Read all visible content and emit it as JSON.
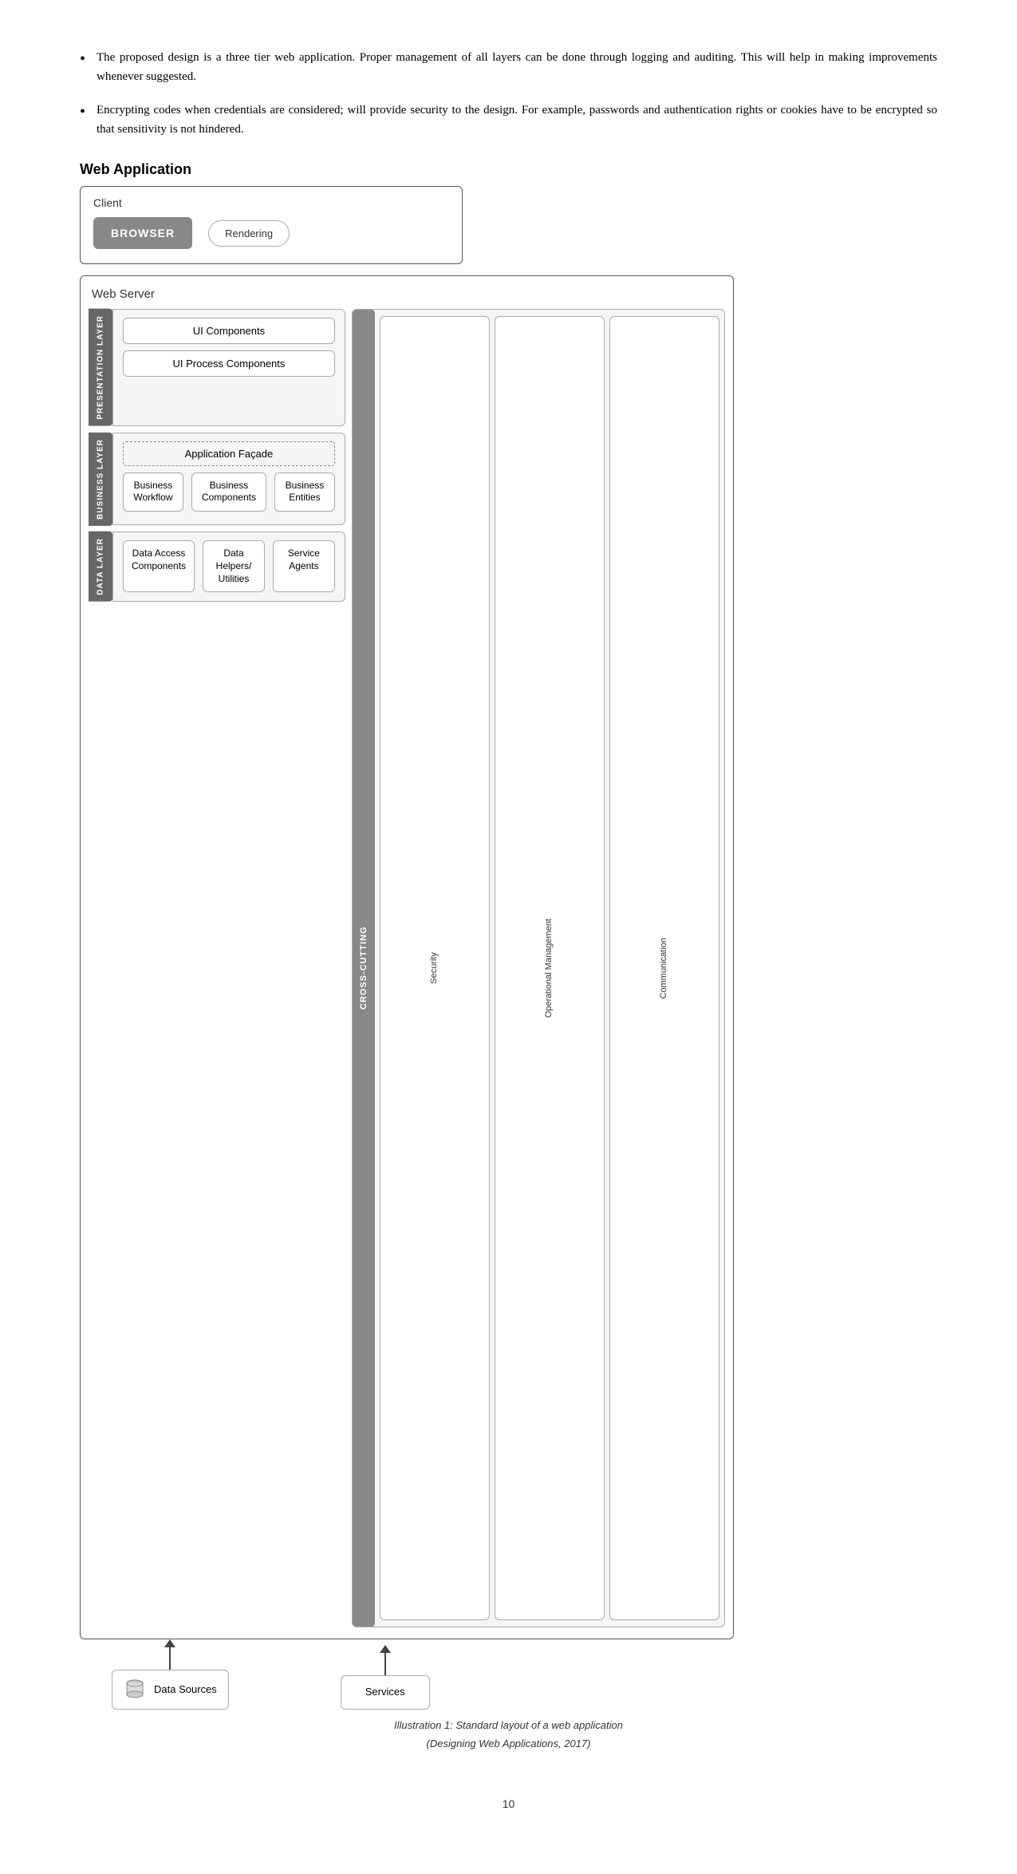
{
  "bullets": [
    {
      "id": "bullet-1",
      "text": "The proposed design is a three tier web application. Proper management of all layers can be done through logging and auditing. This will help in making improvements whenever suggested."
    },
    {
      "id": "bullet-2",
      "text": "Encrypting codes when credentials are considered; will provide security to the design. For example, passwords and authentication rights or cookies have to be encrypted so that sensitivity is not hindered."
    }
  ],
  "diagram": {
    "title": "Web Application",
    "client": {
      "label": "Client",
      "browser": "BROWSER",
      "rendering": "Rendering"
    },
    "webserver": {
      "label": "Web Server",
      "presentation_layer": {
        "label": "PRESENTATION LAYER",
        "components": [
          "UI Components",
          "UI Process Components"
        ]
      },
      "business_layer": {
        "label": "BUSINESS LAYER",
        "facade": "Application Façade",
        "items": [
          "Business Workflow",
          "Business Components",
          "Business Entities"
        ]
      },
      "data_layer": {
        "label": "DATA LAYER",
        "items": [
          "Data Access Components",
          "Data Helpers/ Utilities",
          "Service Agents"
        ]
      },
      "cross_cutting": {
        "label": "CROSS-CUTTING",
        "items": [
          "Security",
          "Operational Management",
          "Communication"
        ]
      }
    },
    "external": {
      "data_sources": "Data Sources",
      "services": "Services"
    },
    "caption_line1": "Illustration 1: Standard layout of a web application",
    "caption_line2": "(Designing Web Applications, 2017)"
  },
  "page_number": "10"
}
